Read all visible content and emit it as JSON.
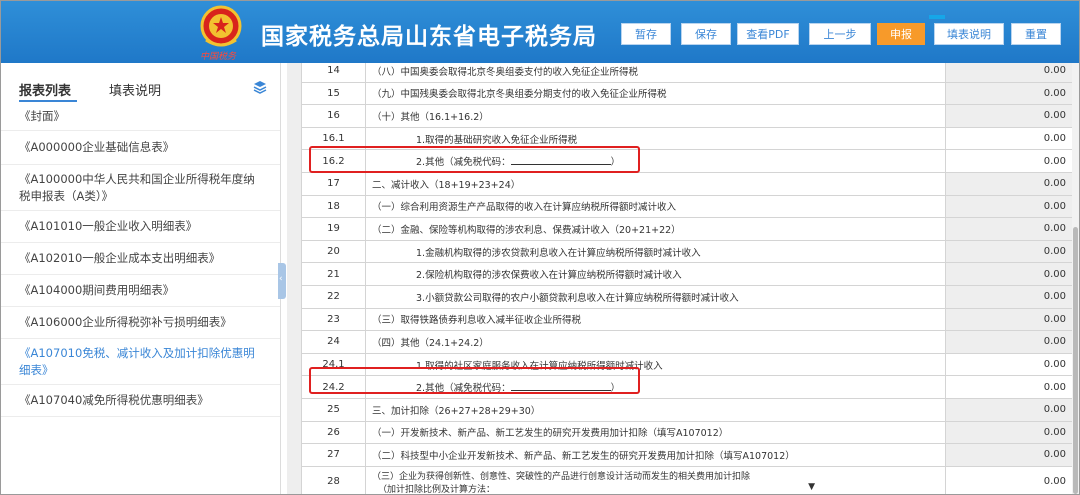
{
  "header": {
    "emblem_caption": "中国税务",
    "title": "国家税务总局山东省电子税务局",
    "buttons": [
      {
        "label": "暂存"
      },
      {
        "label": "保存"
      },
      {
        "label": "查看PDF"
      },
      {
        "label": "上一步"
      },
      {
        "label": "申报"
      },
      {
        "label": "填表说明"
      },
      {
        "label": "重置"
      }
    ]
  },
  "sidebar": {
    "tab_list": "报表列表",
    "tab_help": "填表说明",
    "items": [
      {
        "label": "《封面》"
      },
      {
        "label": "《A000000企业基础信息表》"
      },
      {
        "label": "《A100000中华人民共和国企业所得税年度纳税申报表（A类）》"
      },
      {
        "label": "《A101010一般企业收入明细表》"
      },
      {
        "label": "《A102010一般企业成本支出明细表》"
      },
      {
        "label": "《A104000期间费用明细表》"
      },
      {
        "label": "《A106000企业所得税弥补亏损明细表》"
      },
      {
        "label": "《A107010免税、减计收入及加计扣除优惠明细表》"
      },
      {
        "label": "《A107040减免所得税优惠明细表》"
      }
    ]
  },
  "table": {
    "rows": [
      {
        "no": "14",
        "desc": "（八）中国奥委会取得北京冬奥组委支付的收入免征企业所得税",
        "amount": "0.00"
      },
      {
        "no": "15",
        "desc": "（九）中国残奥委会取得北京冬奥组委分期支付的收入免征企业所得税",
        "amount": "0.00"
      },
      {
        "no": "16",
        "desc": "（十）其他（16.1+16.2）",
        "amount": "0.00"
      },
      {
        "no": "16.1",
        "desc": "1.取得的基础研究收入免征企业所得税",
        "amount": "0.00"
      },
      {
        "no": "16.2",
        "desc": "2.其他（减免税代码：",
        "desc_tail": "）",
        "amount": "0.00"
      },
      {
        "no": "17",
        "desc": "二、减计收入（18+19+23+24）",
        "amount": "0.00"
      },
      {
        "no": "18",
        "desc": "（一）综合利用资源生产产品取得的收入在计算应纳税所得额时减计收入",
        "amount": "0.00"
      },
      {
        "no": "19",
        "desc": "（二）金融、保险等机构取得的涉农利息、保费减计收入（20+21+22）",
        "amount": "0.00"
      },
      {
        "no": "20",
        "desc": "1.金融机构取得的涉农贷款利息收入在计算应纳税所得额时减计收入",
        "amount": "0.00"
      },
      {
        "no": "21",
        "desc": "2.保险机构取得的涉农保费收入在计算应纳税所得额时减计收入",
        "amount": "0.00"
      },
      {
        "no": "22",
        "desc": "3.小额贷款公司取得的农户小额贷款利息收入在计算应纳税所得额时减计收入",
        "amount": "0.00"
      },
      {
        "no": "23",
        "desc": "（三）取得铁路债券利息收入减半征收企业所得税",
        "amount": "0.00"
      },
      {
        "no": "24",
        "desc": "（四）其他（24.1+24.2）",
        "amount": "0.00"
      },
      {
        "no": "24.1",
        "desc": "1.取得的社区家庭服务收入在计算应纳税所得额时减计收入",
        "amount": "0.00"
      },
      {
        "no": "24.2",
        "desc": "2.其他（减免税代码：",
        "desc_tail": "）",
        "amount": "0.00"
      },
      {
        "no": "25",
        "desc": "三、加计扣除（26+27+28+29+30）",
        "amount": "0.00"
      },
      {
        "no": "26",
        "desc": "（一）开发新技术、新产品、新工艺发生的研究开发费用加计扣除（填写A107012）",
        "amount": "0.00"
      },
      {
        "no": "27",
        "desc": "（二）科技型中小企业开发新技术、新产品、新工艺发生的研究开发费用加计扣除（填写A107012）",
        "amount": "0.00"
      },
      {
        "no": "28",
        "desc": "（三）企业为获得创新性、创意性、突破性的产品进行创意设计活动而发生的相关费用加计扣除",
        "desc2": "（加计扣除比例及计算方法：",
        "desc2_tail": "）",
        "amount": "0.00"
      }
    ]
  }
}
